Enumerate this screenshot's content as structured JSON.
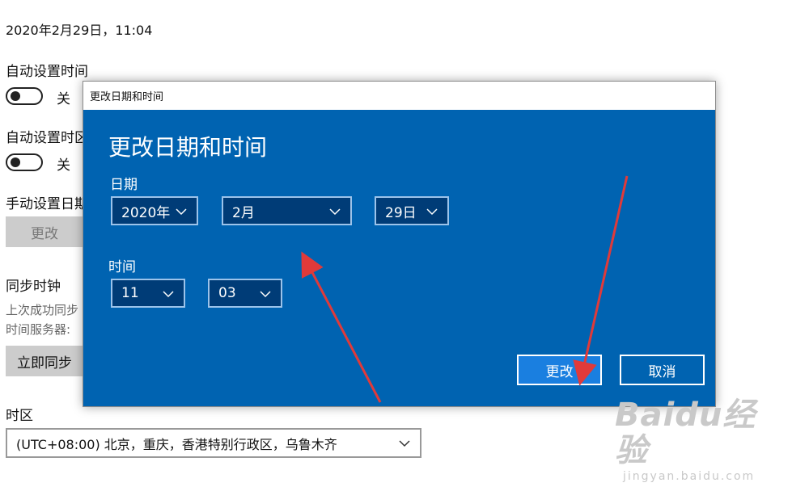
{
  "settings": {
    "current_datetime": "2020年2月29日，11:04",
    "auto_time_label": "自动设置时间",
    "auto_time_state": "关",
    "auto_tz_label": "自动设置时区",
    "auto_tz_state": "关",
    "manual_label": "手动设置日期和时间",
    "manual_change_button": "更改",
    "sync_label": "同步时钟",
    "last_sync_text": "上次成功同步",
    "time_server_text": "时间服务器:",
    "sync_now_button": "立即同步",
    "timezone_label": "时区",
    "timezone_value": "(UTC+08:00) 北京，重庆，香港特别行政区，乌鲁木齐"
  },
  "dialog": {
    "window_title": "更改日期和时间",
    "heading": "更改日期和时间",
    "date_label": "日期",
    "year": "2020年",
    "month": "2月",
    "day": "29日",
    "time_label": "时间",
    "hour": "11",
    "minute": "03",
    "change_button": "更改",
    "cancel_button": "取消"
  },
  "watermark": {
    "main": "Baidu经验",
    "sub": "jingyan.baidu.com"
  },
  "colors": {
    "dialog_bg": "#0063b1",
    "dropdown_bg": "#003c77",
    "primary_button": "#1a7fe0",
    "arrow": "#e03a3a"
  }
}
